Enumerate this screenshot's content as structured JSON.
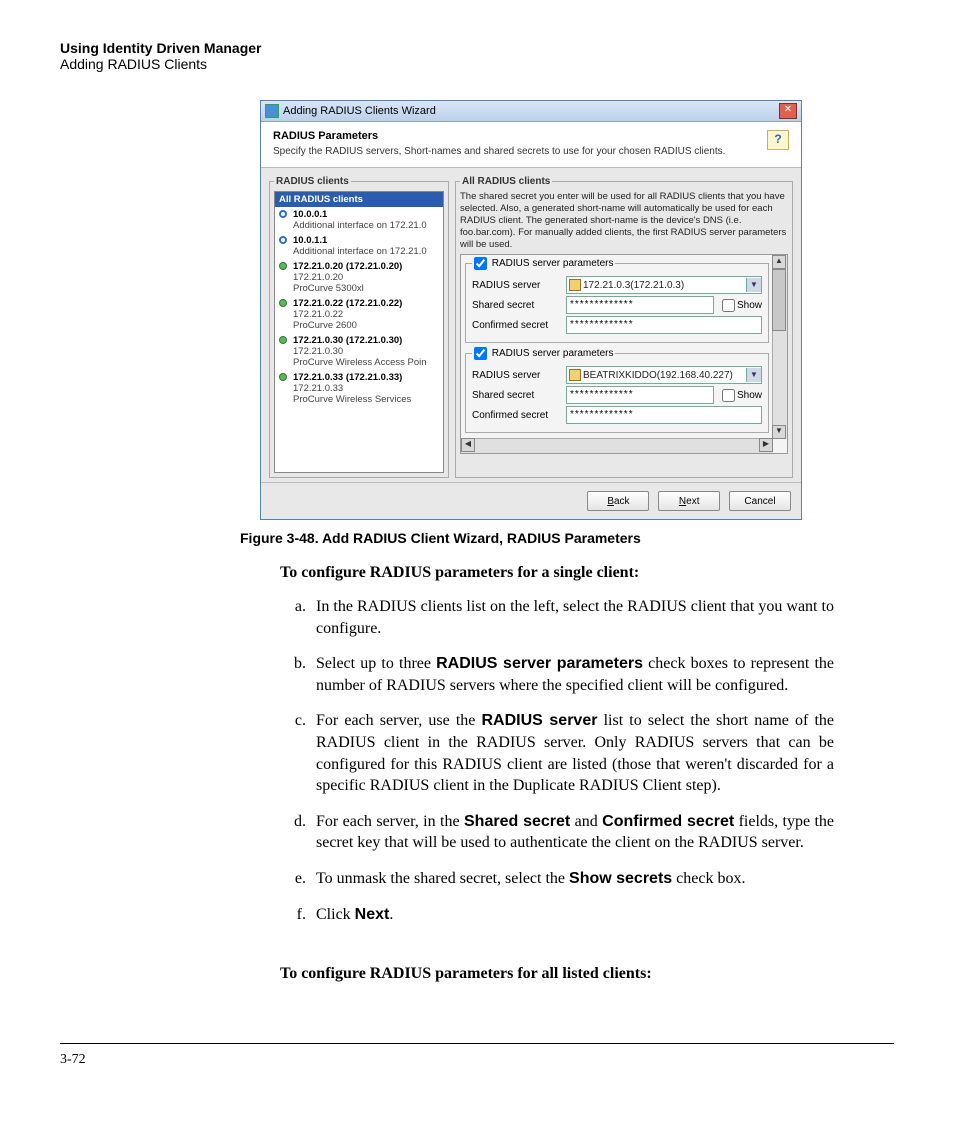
{
  "header": {
    "title": "Using Identity Driven Manager",
    "subtitle": "Adding RADIUS Clients"
  },
  "wizard": {
    "window_title": "Adding RADIUS Clients Wizard",
    "section_title": "RADIUS Parameters",
    "section_desc": "Specify the RADIUS servers, Short-names and shared secrets to use for your chosen RADIUS clients.",
    "clients_legend": "RADIUS clients",
    "clients_selected": "All RADIUS clients",
    "clients": [
      {
        "status": "info",
        "title": "10.0.0.1",
        "sub": "Additional interface on 172.21.0"
      },
      {
        "status": "info",
        "title": "10.0.1.1",
        "sub": "Additional interface on 172.21.0"
      },
      {
        "status": "ok",
        "title": "172.21.0.20 (172.21.0.20)",
        "sub": "172.21.0.20",
        "sub2": "ProCurve 5300xl"
      },
      {
        "status": "ok",
        "title": "172.21.0.22 (172.21.0.22)",
        "sub": "172.21.0.22",
        "sub2": "ProCurve 2600"
      },
      {
        "status": "ok",
        "title": "172.21.0.30 (172.21.0.30)",
        "sub": "172.21.0.30",
        "sub2": "ProCurve Wireless Access Poin"
      },
      {
        "status": "ok",
        "title": "172.21.0.33 (172.21.0.33)",
        "sub": "172.21.0.33",
        "sub2": "ProCurve Wireless Services"
      }
    ],
    "right_legend": "All RADIUS clients",
    "right_desc": "The shared secret you enter will be used for all RADIUS clients that you have selected. Also, a generated short-name will automatically be used for each RADIUS client. The generated short-name is the device's DNS (i.e. foo.bar.com). For manually added clients, the first RADIUS server parameters will be used.",
    "srv_legend": "RADIUS server parameters",
    "lbl_server": "RADIUS server",
    "lbl_secret": "Shared secret",
    "lbl_confirm": "Confirmed secret",
    "show_label": "Show",
    "mask": "*************",
    "server1": "172.21.0.3(172.21.0.3)",
    "server2": "BEATRIXKIDDO(192.168.40.227)",
    "btn_back": "Back",
    "btn_next": "Next",
    "btn_cancel": "Cancel"
  },
  "figure_caption": "Figure 3-48. Add RADIUS Client Wizard, RADIUS Parameters",
  "intro1": "To configure RADIUS parameters for a single client:",
  "steps": {
    "a": "In the RADIUS clients list on the left, select the RADIUS client that you want to configure.",
    "b_pre": "Select up to three ",
    "b_bold": "RADIUS server parameters",
    "b_post": " check boxes to represent the number of RADIUS servers where the specified client will be configured.",
    "c_pre": "For each server, use the ",
    "c_bold": "RADIUS server",
    "c_post": " list to select the short name of the RADIUS client in the RADIUS server. Only RADIUS servers that can be configured for this RADIUS client are listed (those that weren't discarded for a specific RADIUS client in the Duplicate RADIUS Client step).",
    "d_pre": "For each server, in the ",
    "d_b1": "Shared secret",
    "d_mid": " and ",
    "d_b2": "Confirmed secret",
    "d_post": " fields, type the secret key that will be used to authenticate the client on the RADIUS server.",
    "e_pre": "To unmask the shared secret, select the ",
    "e_bold": "Show secrets",
    "e_post": " check box.",
    "f_pre": "Click ",
    "f_bold": "Next",
    "f_post": "."
  },
  "intro2": "To configure RADIUS parameters for all listed clients:",
  "page_number": "3-72"
}
